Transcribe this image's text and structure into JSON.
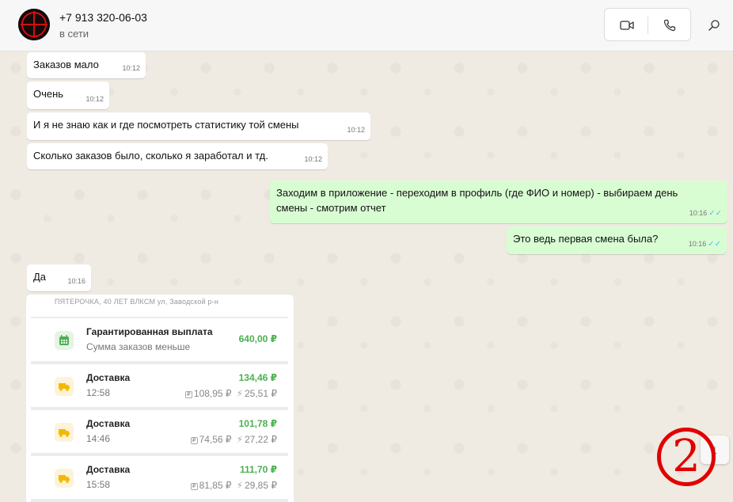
{
  "header": {
    "contact_name": "+7 913 320-06-03",
    "status": "в сети",
    "icons": [
      "video-call-icon",
      "voice-call-icon",
      "search-icon"
    ]
  },
  "messages": [
    {
      "direction": "in",
      "text": "Заказов мало",
      "time": "10:12"
    },
    {
      "direction": "in",
      "text": "Очень",
      "time": "10:12"
    },
    {
      "direction": "in",
      "text": "И я не знаю  как и где посмотреть  статистику  той смены",
      "time": "10:12"
    },
    {
      "direction": "in",
      "text": "Сколько  заказов было, сколько я заработал и тд.",
      "time": "10:12"
    },
    {
      "direction": "out",
      "text": "Заходим в приложение - переходим в профиль (где ФИО и номер) - выбираем день смены - смотрим отчет",
      "time": "10:16",
      "read": "✓✓"
    },
    {
      "direction": "out",
      "text": "Это ведь  первая смена была?",
      "time": "10:16",
      "read": "✓✓"
    },
    {
      "direction": "in",
      "text": "Да",
      "time": "10:16"
    }
  ],
  "screenshot": {
    "header_text": "ПЯТЕРОЧКА, 40 ЛЕТ ВЛКСМ ул, Заводской р-н",
    "rows": [
      {
        "icon": "calendar-icon",
        "title": "Гарантированная выплата",
        "subtitle": "Сумма заказов меньше",
        "amount": "640,00 ₽"
      },
      {
        "icon": "delivery-truck-icon",
        "title": "Доставка",
        "subtitle": "12:58",
        "amount": "134,46 ₽",
        "base": "108,95 ₽",
        "bonus": "25,51 ₽"
      },
      {
        "icon": "delivery-truck-icon",
        "title": "Доставка",
        "subtitle": "14:46",
        "amount": "101,78 ₽",
        "base": "74,56 ₽",
        "bonus": "27,22 ₽"
      },
      {
        "icon": "delivery-truck-icon",
        "title": "Доставка",
        "subtitle": "15:58",
        "amount": "111,70 ₽",
        "base": "81,85 ₽",
        "bonus": "29,85 ₽"
      }
    ]
  },
  "overlay": {
    "number": "2"
  },
  "scroll_down": {
    "icon": "arrow-down-icon",
    "glyph": "↓"
  },
  "colors": {
    "outgoing_bubble": "#d9fdd3",
    "incoming_bubble": "#ffffff",
    "amount_green": "#4caf50",
    "read_ticks": "#53bdeb",
    "annotation_red": "#e00000"
  }
}
